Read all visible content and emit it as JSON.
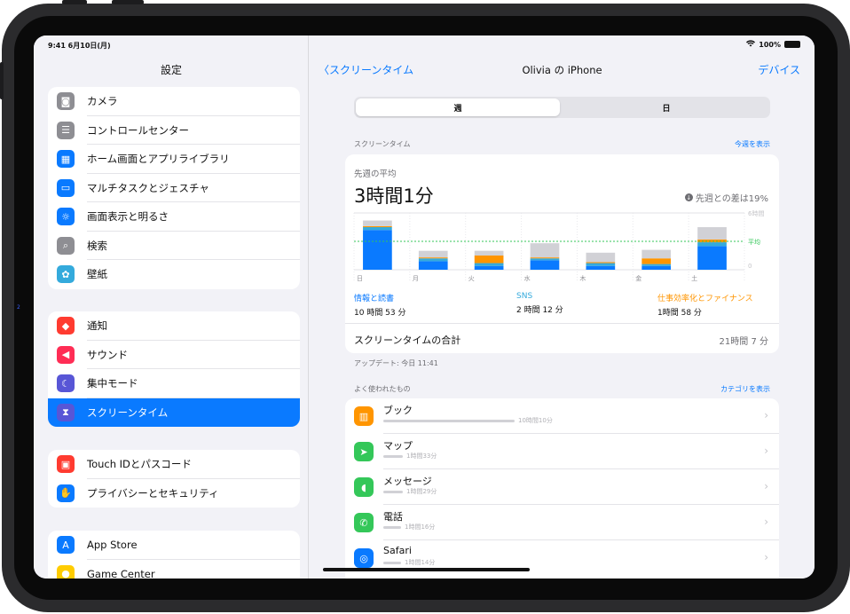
{
  "status_bar": {
    "time_date": "9:41  6月10日(月)",
    "battery": "100%"
  },
  "sidebar": {
    "title": "設定",
    "groups": [
      {
        "items": [
          {
            "label": "カメラ",
            "icon": "camera-icon",
            "color": "#8e8e93",
            "glyph": "◙"
          },
          {
            "label": "コントロールセンター",
            "icon": "toggles-icon",
            "color": "#8e8e93",
            "glyph": "☰"
          },
          {
            "label": "ホーム画面とアプリライブラリ",
            "icon": "home-screen-icon",
            "color": "#0a7aff",
            "glyph": "▦"
          },
          {
            "label": "マルチタスクとジェスチャ",
            "icon": "multitask-icon",
            "color": "#0a7aff",
            "glyph": "▭"
          },
          {
            "label": "画面表示と明るさ",
            "icon": "sun-icon",
            "color": "#0a7aff",
            "glyph": "☼"
          },
          {
            "label": "検索",
            "icon": "search-icon",
            "color": "#8e8e93",
            "glyph": "⌕"
          },
          {
            "label": "壁紙",
            "icon": "wallpaper-icon",
            "color": "#34aadc",
            "glyph": "✿"
          }
        ]
      },
      {
        "items": [
          {
            "label": "通知",
            "icon": "bell-icon",
            "color": "#ff3b30",
            "glyph": "◆"
          },
          {
            "label": "サウンド",
            "icon": "speaker-icon",
            "color": "#ff2d55",
            "glyph": "◀"
          },
          {
            "label": "集中モード",
            "icon": "moon-icon",
            "color": "#5856d6",
            "glyph": "☾"
          },
          {
            "label": "スクリーンタイム",
            "icon": "hourglass-icon",
            "color": "#5856d6",
            "glyph": "⧗",
            "selected": true
          }
        ]
      },
      {
        "items": [
          {
            "label": "Touch IDとパスコード",
            "icon": "lock-icon",
            "color": "#ff3b30",
            "glyph": "▣"
          },
          {
            "label": "プライバシーとセキュリティ",
            "icon": "hand-icon",
            "color": "#0a7aff",
            "glyph": "✋"
          }
        ]
      },
      {
        "items": [
          {
            "label": "App Store",
            "icon": "app-store-icon",
            "color": "#0a7aff",
            "glyph": "A"
          },
          {
            "label": "Game Center",
            "icon": "game-center-icon",
            "color": "#ffcc00",
            "glyph": "●"
          }
        ]
      }
    ]
  },
  "nav": {
    "back_label": "スクリーンタイム",
    "title": "Olivia の iPhone",
    "right_label": "デバイス"
  },
  "segments": {
    "week": "週",
    "day": "日"
  },
  "screen_time": {
    "header": "スクリーンタイム",
    "link": "今週を表示",
    "avg_label": "先週の平均",
    "avg_value": "3時間1分",
    "diff": "先週との差は19%",
    "categories": [
      {
        "name": "情報と読書",
        "value": "10 時間 53 分",
        "color": "#0a7aff"
      },
      {
        "name": "SNS",
        "value": "2 時間 12 分",
        "color": "#34aadc"
      },
      {
        "name": "仕事効率化とファイナンス",
        "value": "1時間 58 分",
        "color": "#ff9500"
      }
    ],
    "total_label": "スクリーンタイムの合計",
    "total_value": "21時間 7 分",
    "updated": "アップデート: 今日 11:41"
  },
  "chart_data": {
    "type": "bar",
    "categories": [
      "日",
      "月",
      "火",
      "水",
      "木",
      "金",
      "土"
    ],
    "series": [
      {
        "name": "情報と読書",
        "values": [
          4.2,
          0.9,
          0.4,
          1.0,
          0.4,
          0.4,
          2.5
        ]
      },
      {
        "name": "SNS",
        "values": [
          0.3,
          0.3,
          0.3,
          0.2,
          0.3,
          0.2,
          0.4
        ]
      },
      {
        "name": "仕事効率化とファイナンス",
        "values": [
          0.1,
          0.1,
          0.8,
          0.1,
          0.1,
          0.6,
          0.3
        ]
      },
      {
        "name": "other",
        "values": [
          0.6,
          0.7,
          0.5,
          1.5,
          1.0,
          0.9,
          1.3
        ]
      }
    ],
    "colors": [
      "#0a7aff",
      "#34aadc",
      "#ff9500",
      "#d1d1d6"
    ],
    "y_ticks": [
      "6時間",
      "平均",
      "0"
    ],
    "average": 3.0,
    "ylim": [
      0,
      6
    ]
  },
  "most_used": {
    "header": "よく使われたもの",
    "link": "カテゴリを表示",
    "apps": [
      {
        "name": "ブック",
        "time": "10時間10分",
        "usage": 0.74,
        "icon": "books-icon",
        "color": "#ff9500",
        "glyph": "▥"
      },
      {
        "name": "マップ",
        "time": "1時間33分",
        "usage": 0.11,
        "icon": "maps-icon",
        "color": "#34c759",
        "glyph": "➤"
      },
      {
        "name": "メッセージ",
        "time": "1時間29分",
        "usage": 0.11,
        "icon": "messages-icon",
        "color": "#34c759",
        "glyph": "◖"
      },
      {
        "name": "電話",
        "time": "1時間16分",
        "usage": 0.09,
        "icon": "phone-icon",
        "color": "#34c759",
        "glyph": "✆"
      },
      {
        "name": "Safari",
        "time": "1時間14分",
        "usage": 0.09,
        "icon": "safari-icon",
        "color": "#0a7aff",
        "glyph": "◎"
      }
    ]
  }
}
